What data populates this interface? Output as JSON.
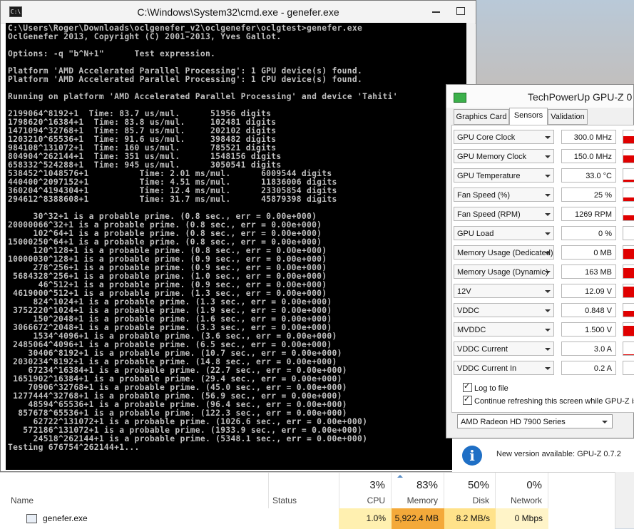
{
  "cmd": {
    "title": "C:\\Windows\\System32\\cmd.exe - genefer.exe",
    "icon_text": "C:\\",
    "console_lines": [
      "C:\\Users\\Roger\\Downloads\\oclgenefer_v2\\oclgenefer\\oclgtest>genefer.exe",
      "OclGenefer 2013, Copyright (C) 2001-2013, Yves Gallot.",
      "",
      "Options: -q \"b^N+1\"      Test expression.",
      "",
      "Platform 'AMD Accelerated Parallel Processing': 1 GPU device(s) found.",
      "Platform 'AMD Accelerated Parallel Processing': 1 CPU device(s) found.",
      "",
      "Running on platform 'AMD Accelerated Parallel Processing' and device 'Tahiti'",
      "",
      "2199064^8192+1  Time: 83.7 us/mul.      51956 digits",
      "1798620^16384+1  Time: 83.8 us/mul.     102481 digits",
      "1471094^32768+1  Time: 85.7 us/mul.     202102 digits",
      "1203210^65536+1  Time: 91.6 us/mul.     398482 digits",
      "984108^131072+1  Time: 160 us/mul.      785521 digits",
      "804904^262144+1  Time: 351 us/mul.      1548156 digits",
      "658332^524288+1  Time: 945 us/mul.      3050541 digits",
      "538452^1048576+1          Time: 2.01 ms/mul.      6009544 digits",
      "440400^2097152+1          Time: 4.51 ms/mul.      11836006 digits",
      "360204^4194304+1          Time: 12.4 ms/mul.      23305854 digits",
      "294612^8388608+1          Time: 31.7 ms/mul.      45879398 digits",
      "",
      "     30^32+1 is a probable prime. (0.8 sec., err = 0.00e+000)",
      "20000066^32+1 is a probable prime. (0.8 sec., err = 0.00e+000)",
      "     102^64+1 is a probable prime. (0.8 sec., err = 0.00e+000)",
      "15000250^64+1 is a probable prime. (0.8 sec., err = 0.00e+000)",
      "     120^128+1 is a probable prime. (0.8 sec., err = 0.00e+000)",
      "10000030^128+1 is a probable prime. (0.9 sec., err = 0.00e+000)",
      "     278^256+1 is a probable prime. (0.9 sec., err = 0.00e+000)",
      " 5684328^256+1 is a probable prime. (1.0 sec., err = 0.00e+000)",
      "      46^512+1 is a probable prime. (0.9 sec., err = 0.00e+000)",
      " 4619000^512+1 is a probable prime. (1.3 sec., err = 0.00e+000)",
      "     824^1024+1 is a probable prime. (1.3 sec., err = 0.00e+000)",
      " 3752220^1024+1 is a probable prime. (1.9 sec., err = 0.00e+000)",
      "     150^2048+1 is a probable prime. (1.6 sec., err = 0.00e+000)",
      " 3066672^2048+1 is a probable prime. (3.3 sec., err = 0.00e+000)",
      "     1534^4096+1 is a probable prime. (3.6 sec., err = 0.00e+000)",
      " 2485064^4096+1 is a probable prime. (6.5 sec., err = 0.00e+000)",
      "    30406^8192+1 is a probable prime. (10.7 sec., err = 0.00e+000)",
      " 2030234^8192+1 is a probable prime. (14.8 sec., err = 0.00e+000)",
      "    67234^16384+1 is a probable prime. (22.7 sec., err = 0.00e+000)",
      " 1651902^16384+1 is a probable prime. (29.4 sec., err = 0.00e+000)",
      "    70906^32768+1 is a probable prime. (45.0 sec., err = 0.00e+000)",
      " 1277444^32768+1 is a probable prime. (56.9 sec., err = 0.00e+000)",
      "    48594^65536+1 is a probable prime. (96.4 sec., err = 0.00e+000)",
      "  857678^65536+1 is a probable prime. (122.3 sec., err = 0.00e+000)",
      "     62722^131072+1 is a probable prime. (1026.6 sec., err = 0.00e+000)",
      "   572186^131072+1 is a probable prime. (1933.9 sec., err = 0.00e+000)",
      "     24518^262144+1 is a probable prime. (5348.1 sec., err = 0.00e+000)",
      "Testing 676754^262144+1..."
    ]
  },
  "gpuz": {
    "title": "TechPowerUp GPU-Z 0",
    "tabs": [
      "Graphics Card",
      "Sensors",
      "Validation"
    ],
    "sensors": [
      {
        "label": "GPU Core Clock",
        "value": "300.0 MHz",
        "level": 0.55
      },
      {
        "label": "GPU Memory Clock",
        "value": "150.0 MHz",
        "level": 0.55
      },
      {
        "label": "GPU Temperature",
        "value": "33.0 °C",
        "level": 0.15
      },
      {
        "label": "Fan Speed (%)",
        "value": "25 %",
        "level": 0.25
      },
      {
        "label": "Fan Speed (RPM)",
        "value": "1269 RPM",
        "level": 0.4
      },
      {
        "label": "GPU Load",
        "value": "0 %",
        "level": 0.0
      },
      {
        "label": "Memory Usage (Dedicated)",
        "value": "0 MB",
        "level": 0.8
      },
      {
        "label": "Memory Usage (Dynamic)",
        "value": "163 MB",
        "level": 0.8
      },
      {
        "label": "12V",
        "value": "12.09 V",
        "level": 0.85
      },
      {
        "label": "VDDC",
        "value": "0.848 V",
        "level": 0.45
      },
      {
        "label": "MVDDC",
        "value": "1.500 V",
        "level": 0.8
      },
      {
        "label": "VDDC Current",
        "value": "3.0 A",
        "level": 0.05
      },
      {
        "label": "VDDC Current In",
        "value": "0.2 A",
        "level": 0.0
      }
    ],
    "log_to_file": "Log to file",
    "continue_refresh": "Continue refreshing this screen while GPU-Z is in",
    "device": "AMD Radeon HD 7900 Series",
    "notification": "New version available: GPU-Z 0.7.2",
    "info_icon": "i"
  },
  "taskmgr": {
    "name_header": "Name",
    "status_header": "Status",
    "columns": [
      {
        "pct": "3%",
        "label": "CPU"
      },
      {
        "pct": "83%",
        "label": "Memory"
      },
      {
        "pct": "50%",
        "label": "Disk"
      },
      {
        "pct": "0%",
        "label": "Network"
      }
    ],
    "process": {
      "name": "genefer.exe",
      "cpu": "1.0%",
      "memory": "5,922.4 MB",
      "disk": "8.2 MB/s",
      "network": "0 Mbps"
    },
    "colors": {
      "cpu": "#fff0b0",
      "memory": "#f4a93a",
      "disk": "#ffe28a",
      "network": "#fff4c8"
    }
  }
}
